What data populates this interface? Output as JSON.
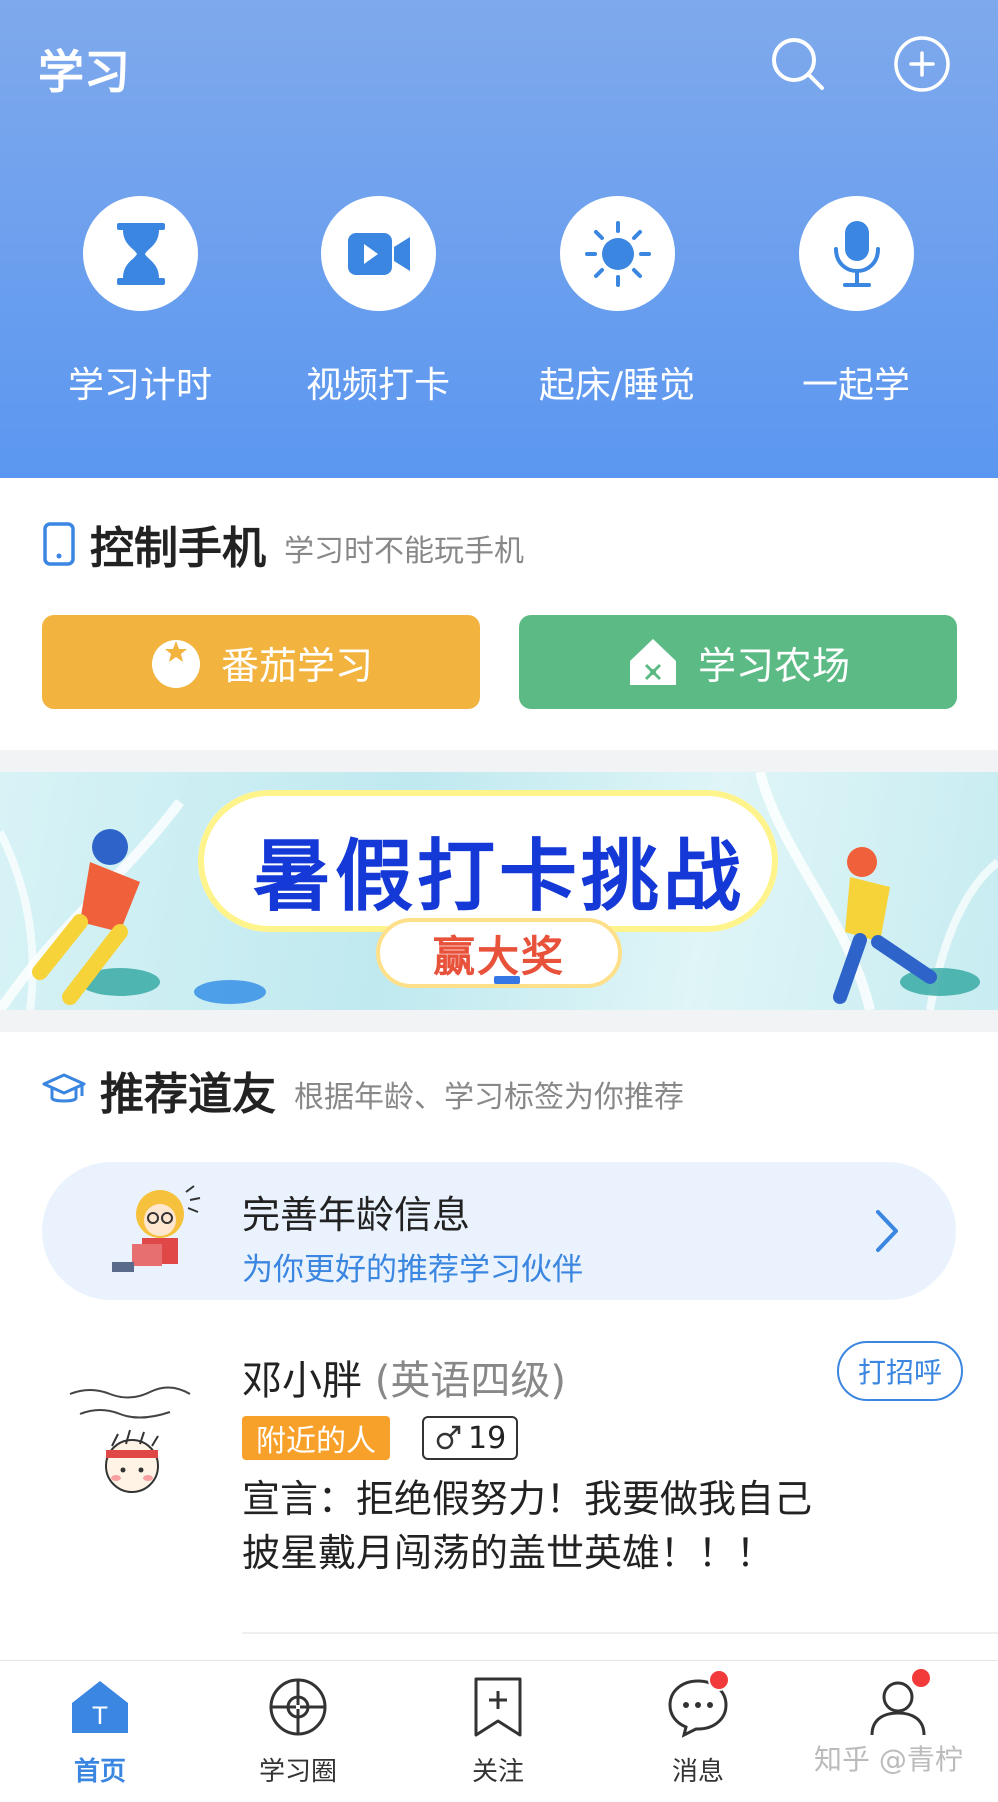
{
  "header": {
    "title": "学习",
    "quick_actions": [
      {
        "label": "学习计时",
        "icon": "hourglass-icon"
      },
      {
        "label": "视频打卡",
        "icon": "video-camera-icon"
      },
      {
        "label": "起床/睡觉",
        "icon": "sun-icon"
      },
      {
        "label": "一起学",
        "icon": "microphone-icon"
      }
    ]
  },
  "control_phone": {
    "title": "控制手机",
    "subtitle": "学习时不能玩手机",
    "tomato_label": "番茄学习",
    "farm_label": "学习农场"
  },
  "banner": {
    "title": "暑假打卡挑战",
    "subtitle": "赢大奖"
  },
  "recommend": {
    "title": "推荐道友",
    "subtitle": "根据年龄、学习标签为你推荐",
    "info_card": {
      "title": "完善年龄信息",
      "subtitle": "为你更好的推荐学习伙伴"
    },
    "friend": {
      "name": "邓小胖",
      "level": "(英语四级)",
      "greet_label": "打招呼",
      "tag_nearby": "附近的人",
      "age": "19",
      "declaration": "宣言：拒绝假努力！我要做我自己披星戴月闯荡的盖世英雄！！！"
    }
  },
  "tabbar": {
    "items": [
      {
        "label": "首页",
        "active": true
      },
      {
        "label": "学习圈",
        "active": false
      },
      {
        "label": "关注",
        "active": false
      },
      {
        "label": "消息",
        "active": false,
        "badge": true
      },
      {
        "label": "",
        "active": false,
        "badge": true
      }
    ]
  },
  "watermark": "知乎 @青柠",
  "colors": {
    "primary_blue": "#3a86e0",
    "header_blue": "#5b97f0",
    "tomato_orange": "#f2b33f",
    "farm_green": "#5cbb85",
    "badge_red": "#f23a3a"
  }
}
